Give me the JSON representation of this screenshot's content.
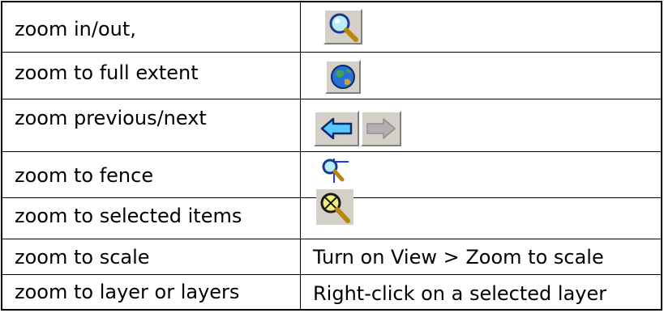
{
  "rows": [
    {
      "label": "zoom in/out,",
      "icon": "zoom-magnifier-icon"
    },
    {
      "label": "zoom to full extent",
      "icon": "globe-icon"
    },
    {
      "label": "zoom previous/next",
      "icon": "back-arrow-icon, forward-arrow-icon"
    },
    {
      "label": "zoom to fence",
      "icon": "zoom-fence-icon"
    },
    {
      "label": "zoom to selected items",
      "icon": "zoom-selected-icon"
    },
    {
      "label": "zoom to scale",
      "description": "Turn on View > Zoom to scale"
    },
    {
      "label": "zoom to layer or layers",
      "description": "Right-click on a selected layer"
    }
  ]
}
